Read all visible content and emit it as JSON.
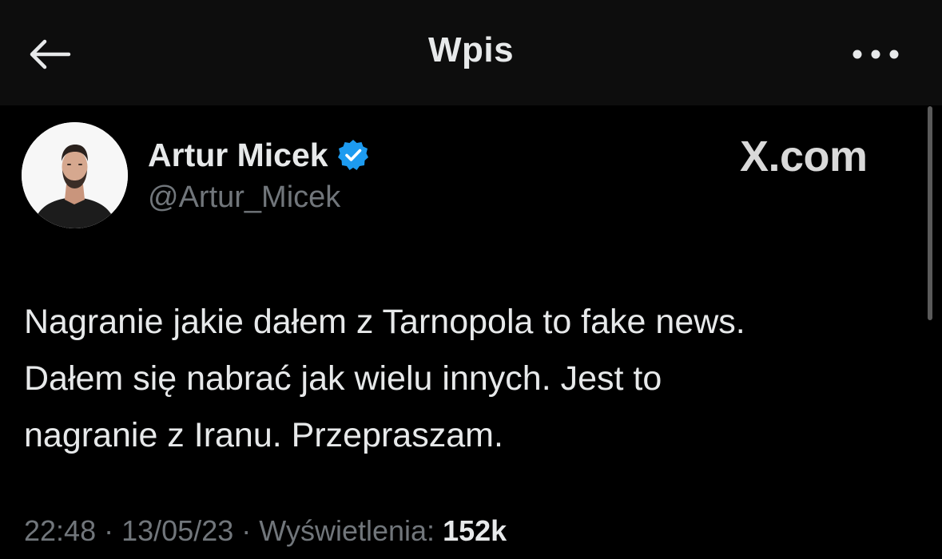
{
  "header": {
    "title": "Wpis",
    "back_icon": "arrow-left-icon",
    "more_icon": "more-horizontal-icon"
  },
  "tweet": {
    "author": {
      "name": "Artur Micek",
      "handle": "@Artur_Micek",
      "verified": true,
      "verified_color": "#1d9bf0"
    },
    "brand_mark": "X.com",
    "text_lines": [
      "Nagranie jakie dałem z Tarnopola to fake news.",
      "Dałem się nabrać jak wielu innych. Jest to",
      "nagranie z Iranu. Przepraszam."
    ],
    "time": "22:48",
    "date": "13/05/23",
    "views_label": "Wyświetlenia:",
    "views_count": "152k",
    "separator": "·"
  },
  "colors": {
    "background": "#000000",
    "header_background": "#0d0d0d",
    "primary_text": "#e7e9ea",
    "secondary_text": "#71767b",
    "accent": "#1d9bf0"
  }
}
